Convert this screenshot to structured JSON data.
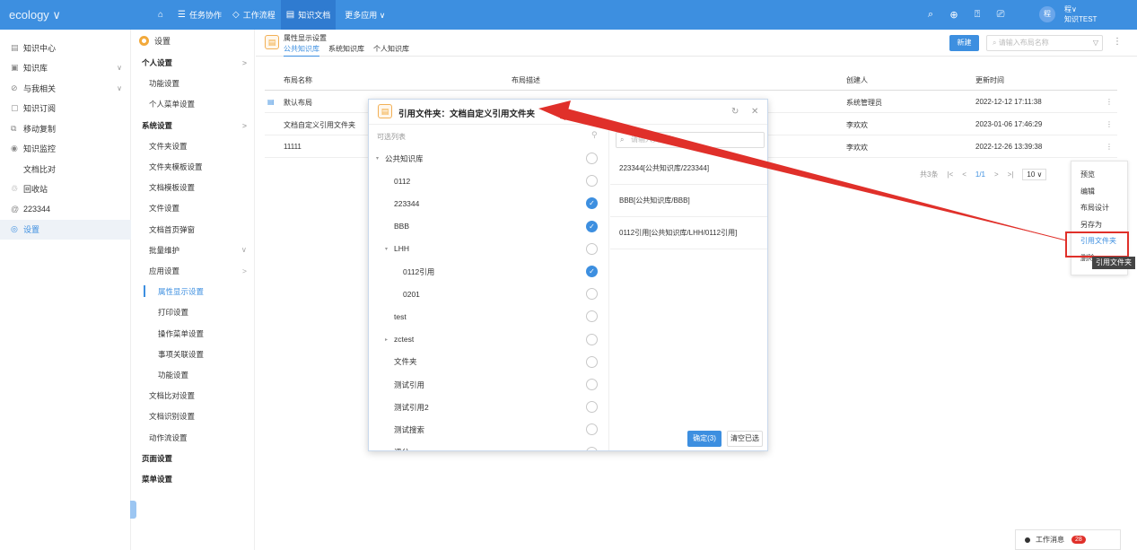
{
  "topbar": {
    "logo": "ecology ∨",
    "nav": [
      {
        "icon": "⌂",
        "label": ""
      },
      {
        "icon": "☰",
        "label": "任务协作"
      },
      {
        "icon": "◇",
        "label": "工作流程"
      },
      {
        "icon": "▤",
        "label": "知识文档"
      },
      {
        "icon": "",
        "label": "更多应用 ∨"
      }
    ],
    "icons": [
      "search-icon",
      "plus-icon",
      "help-icon",
      "message-icon"
    ],
    "avatar_text": "程",
    "user_line1": "程∨",
    "user_line2": "知识TEST",
    "colors": {
      "bar": "#3d8fe0",
      "active": "#2f7bd0",
      "accent": "#3d8fe0",
      "highlight": "#e0302a"
    }
  },
  "sidebar": {
    "items": [
      {
        "icon": "▤",
        "label": "知识中心",
        "arrow": ""
      },
      {
        "icon": "▣",
        "label": "知识库",
        "arrow": "∨"
      },
      {
        "icon": "⊘",
        "label": "与我相关",
        "arrow": "∨"
      },
      {
        "icon": "▢",
        "label": "知识订阅",
        "arrow": ""
      },
      {
        "icon": "⧉",
        "label": "移动复制",
        "arrow": ""
      },
      {
        "icon": "◉",
        "label": "知识监控",
        "arrow": ""
      },
      {
        "icon": "",
        "label": "文档比对",
        "arrow": ""
      },
      {
        "icon": "♲",
        "label": "回收站",
        "arrow": ""
      },
      {
        "icon": "@",
        "label": "223344",
        "arrow": ""
      },
      {
        "icon": "◎",
        "label": "设置",
        "arrow": ""
      }
    ]
  },
  "settings": {
    "title": "设置",
    "items": [
      {
        "label": "个人设置",
        "level": 0,
        "arrow": ">"
      },
      {
        "label": "功能设置",
        "level": 1,
        "arrow": ""
      },
      {
        "label": "个人菜单设置",
        "level": 1,
        "arrow": ""
      },
      {
        "label": "系统设置",
        "level": 0,
        "arrow": ">"
      },
      {
        "label": "文件夹设置",
        "level": 1,
        "arrow": ""
      },
      {
        "label": "文件夹模板设置",
        "level": 1,
        "arrow": ""
      },
      {
        "label": "文档模板设置",
        "level": 1,
        "arrow": ""
      },
      {
        "label": "文件设置",
        "level": 1,
        "arrow": ""
      },
      {
        "label": "文档首页弹窗",
        "level": 1,
        "arrow": ""
      },
      {
        "label": "批量维护",
        "level": 1,
        "arrow": "∨"
      },
      {
        "label": "应用设置",
        "level": 1,
        "arrow": ">"
      },
      {
        "label": "属性显示设置",
        "level": 2,
        "arrow": "",
        "selected": true
      },
      {
        "label": "打印设置",
        "level": 2,
        "arrow": ""
      },
      {
        "label": "操作菜单设置",
        "level": 2,
        "arrow": ""
      },
      {
        "label": "事项关联设置",
        "level": 2,
        "arrow": ""
      },
      {
        "label": "功能设置",
        "level": 2,
        "arrow": ""
      },
      {
        "label": "文档比对设置",
        "level": 1,
        "arrow": ""
      },
      {
        "label": "文档识别设置",
        "level": 1,
        "arrow": ""
      },
      {
        "label": "动作流设置",
        "level": 1,
        "arrow": ""
      },
      {
        "label": "页面设置",
        "level": 0,
        "arrow": ""
      },
      {
        "label": "菜单设置",
        "level": 0,
        "arrow": ""
      }
    ]
  },
  "page": {
    "title": "属性显示设置",
    "tabs": [
      "公共知识库",
      "系统知识库",
      "个人知识库"
    ],
    "new_button": "新建",
    "search_placeholder": "请输入布局名称",
    "table": {
      "headers": [
        "布局名称",
        "布局描述",
        "创建人",
        "更新时间"
      ],
      "rows": [
        {
          "name": "默认布局",
          "desc": "",
          "creator": "系统管理员",
          "time": "2022-12-12 17:11:38"
        },
        {
          "name": "文档自定义引用文件夹",
          "desc": "",
          "creator": "李欢欢",
          "time": "2023-01-06 17:46:29"
        },
        {
          "name": "11111",
          "desc": "",
          "creator": "李欢欢",
          "time": "2022-12-26 13:39:38"
        }
      ]
    },
    "pager": {
      "total": "共3条",
      "page": "1/1",
      "size": "10 ∨"
    }
  },
  "context_menu": {
    "items": [
      "预览",
      "编辑",
      "布局设计",
      "另存为",
      "引用文件夹",
      "删除"
    ],
    "highlight_index": 4,
    "tooltip": "引用文件夹"
  },
  "dialog": {
    "title": "引用文件夹：文档自定义引用文件夹",
    "left_header": "可选列表",
    "tree": [
      {
        "label": "公共知识库",
        "depth": 0,
        "toggle": "▾",
        "checked": false
      },
      {
        "label": "0112",
        "depth": 1,
        "toggle": "",
        "checked": false
      },
      {
        "label": "223344",
        "depth": 1,
        "toggle": "",
        "checked": true
      },
      {
        "label": "BBB",
        "depth": 1,
        "toggle": "",
        "checked": true
      },
      {
        "label": "LHH",
        "depth": 1,
        "toggle": "▾",
        "checked": false
      },
      {
        "label": "0112引用",
        "depth": 2,
        "toggle": "",
        "checked": true
      },
      {
        "label": "0201",
        "depth": 2,
        "toggle": "",
        "checked": false
      },
      {
        "label": "test",
        "depth": 1,
        "toggle": "",
        "checked": false
      },
      {
        "label": "zctest",
        "depth": 1,
        "toggle": "▸",
        "checked": false
      },
      {
        "label": "文件夹",
        "depth": 1,
        "toggle": "",
        "checked": false
      },
      {
        "label": "测试引用",
        "depth": 1,
        "toggle": "",
        "checked": false
      },
      {
        "label": "测试引用2",
        "depth": 1,
        "toggle": "",
        "checked": false
      },
      {
        "label": "测试搜索",
        "depth": 1,
        "toggle": "",
        "checked": false
      },
      {
        "label": "评分",
        "depth": 1,
        "toggle": "▸",
        "checked": false
      }
    ],
    "right_search_placeholder": "请输入关键字",
    "selected": [
      "223344[公共知识库/223344]",
      "BBB[公共知识库/BBB]",
      "0112引用[公共知识库/LHH/0112引用]"
    ],
    "ok_button": "确定(3)",
    "clear_button": "清空已选"
  },
  "footer": {
    "work_message": "工作消息",
    "badge": "28"
  }
}
